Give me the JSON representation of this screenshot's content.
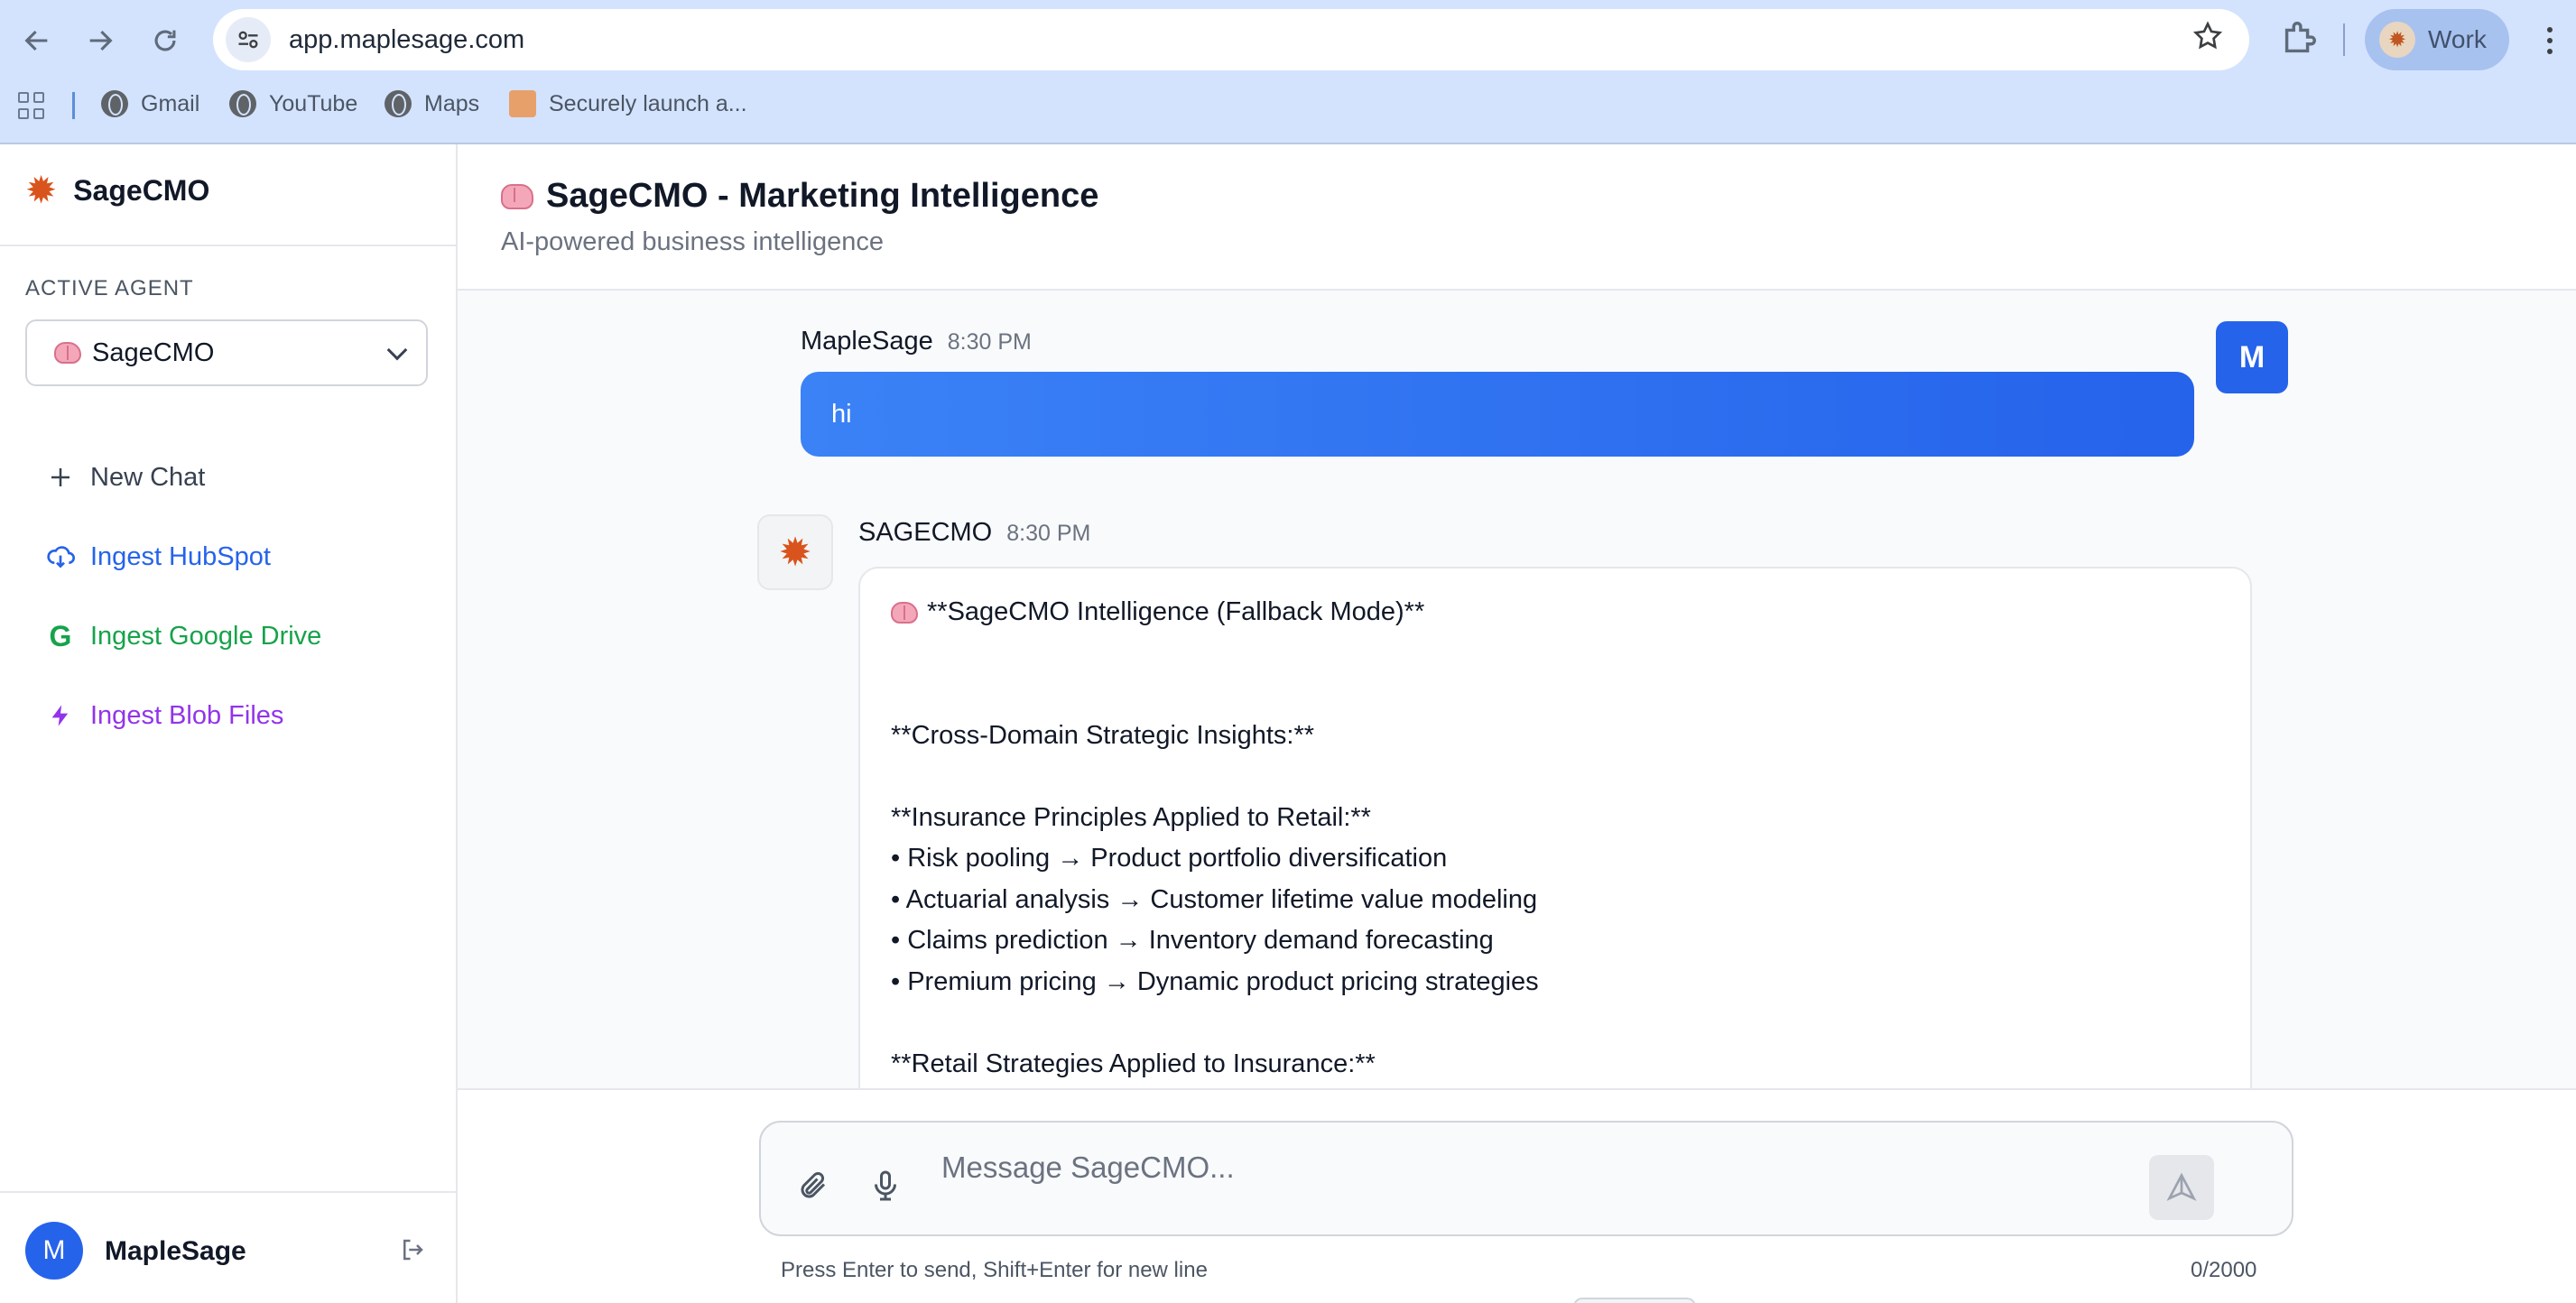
{
  "browser": {
    "url": "app.maplesage.com",
    "profile_label": "Work",
    "bookmarks": [
      {
        "label": "Gmail"
      },
      {
        "label": "YouTube"
      },
      {
        "label": "Maps"
      },
      {
        "label": "Securely launch a..."
      }
    ]
  },
  "sidebar": {
    "brand": "SageCMO",
    "agent_label": "ACTIVE AGENT",
    "agent_selected": "SageCMO",
    "items": [
      {
        "label": "New Chat",
        "icon": "plus-icon",
        "color": "#374151"
      },
      {
        "label": "Ingest HubSpot",
        "icon": "cloud-download-icon",
        "color": "#2563eb"
      },
      {
        "label": "Ingest Google Drive",
        "icon": "google-icon",
        "color": "#16a34a"
      },
      {
        "label": "Ingest Blob Files",
        "icon": "lightning-icon",
        "color": "#9333ea"
      }
    ],
    "user": {
      "initial": "M",
      "name": "MapleSage"
    }
  },
  "header": {
    "title": "SageCMO - Marketing Intelligence",
    "subtitle": "AI-powered business intelligence"
  },
  "messages": {
    "user": {
      "name": "MapleSage",
      "time": "8:30 PM",
      "text": "hi",
      "initial": "M"
    },
    "bot": {
      "name": "SAGECMO",
      "time": "8:30 PM",
      "lines": [
        "**SageCMO Intelligence (Fallback Mode)**",
        "",
        "",
        "**Cross-Domain Strategic Insights:**",
        "",
        "**Insurance Principles Applied to Retail:**",
        "• Risk pooling → Product portfolio diversification",
        "• Actuarial analysis → Customer lifetime value modeling",
        "• Claims prediction → Inventory demand forecasting",
        "• Premium pricing → Dynamic product pricing strategies",
        "",
        "**Retail Strategies Applied to Insurance:**"
      ]
    }
  },
  "composer": {
    "placeholder": "Message SageCMO...",
    "hint": "Press Enter to send, Shift+Enter for new line",
    "counter": "0/2000"
  },
  "colors": {
    "accent": "#2563eb",
    "chrome": "#d3e3fd"
  }
}
